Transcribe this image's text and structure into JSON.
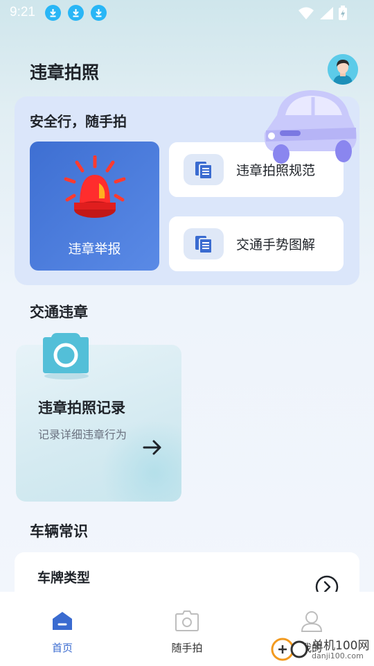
{
  "status_bar": {
    "time": "9:21",
    "download_count": 3
  },
  "header": {
    "title": "违章拍照"
  },
  "safety_card": {
    "title": "安全行，随手拍",
    "report_label": "违章举报",
    "items": [
      {
        "label": "违章拍照规范",
        "icon": "document-icon"
      },
      {
        "label": "交通手势图解",
        "icon": "document-icon"
      }
    ]
  },
  "traffic_section": {
    "heading": "交通违章",
    "record_card": {
      "title": "违章拍照记录",
      "subtitle": "记录详细违章行为"
    }
  },
  "vehicle_section": {
    "heading": "车辆常识",
    "plate_card": {
      "title": "车牌类型"
    }
  },
  "bottom_nav": {
    "items": [
      {
        "label": "首页",
        "active": true
      },
      {
        "label": "随手拍",
        "active": false
      },
      {
        "label": "我的",
        "active": false
      }
    ]
  },
  "watermark": {
    "line1": "单机100网",
    "line2": "danji100.com"
  },
  "colors": {
    "accent": "#3e6fd2",
    "report_tile": "#4a7de0",
    "safety_card_bg": "#dbe6fa",
    "nav_active": "#3a6bd0",
    "nav_inactive": "#333333"
  }
}
